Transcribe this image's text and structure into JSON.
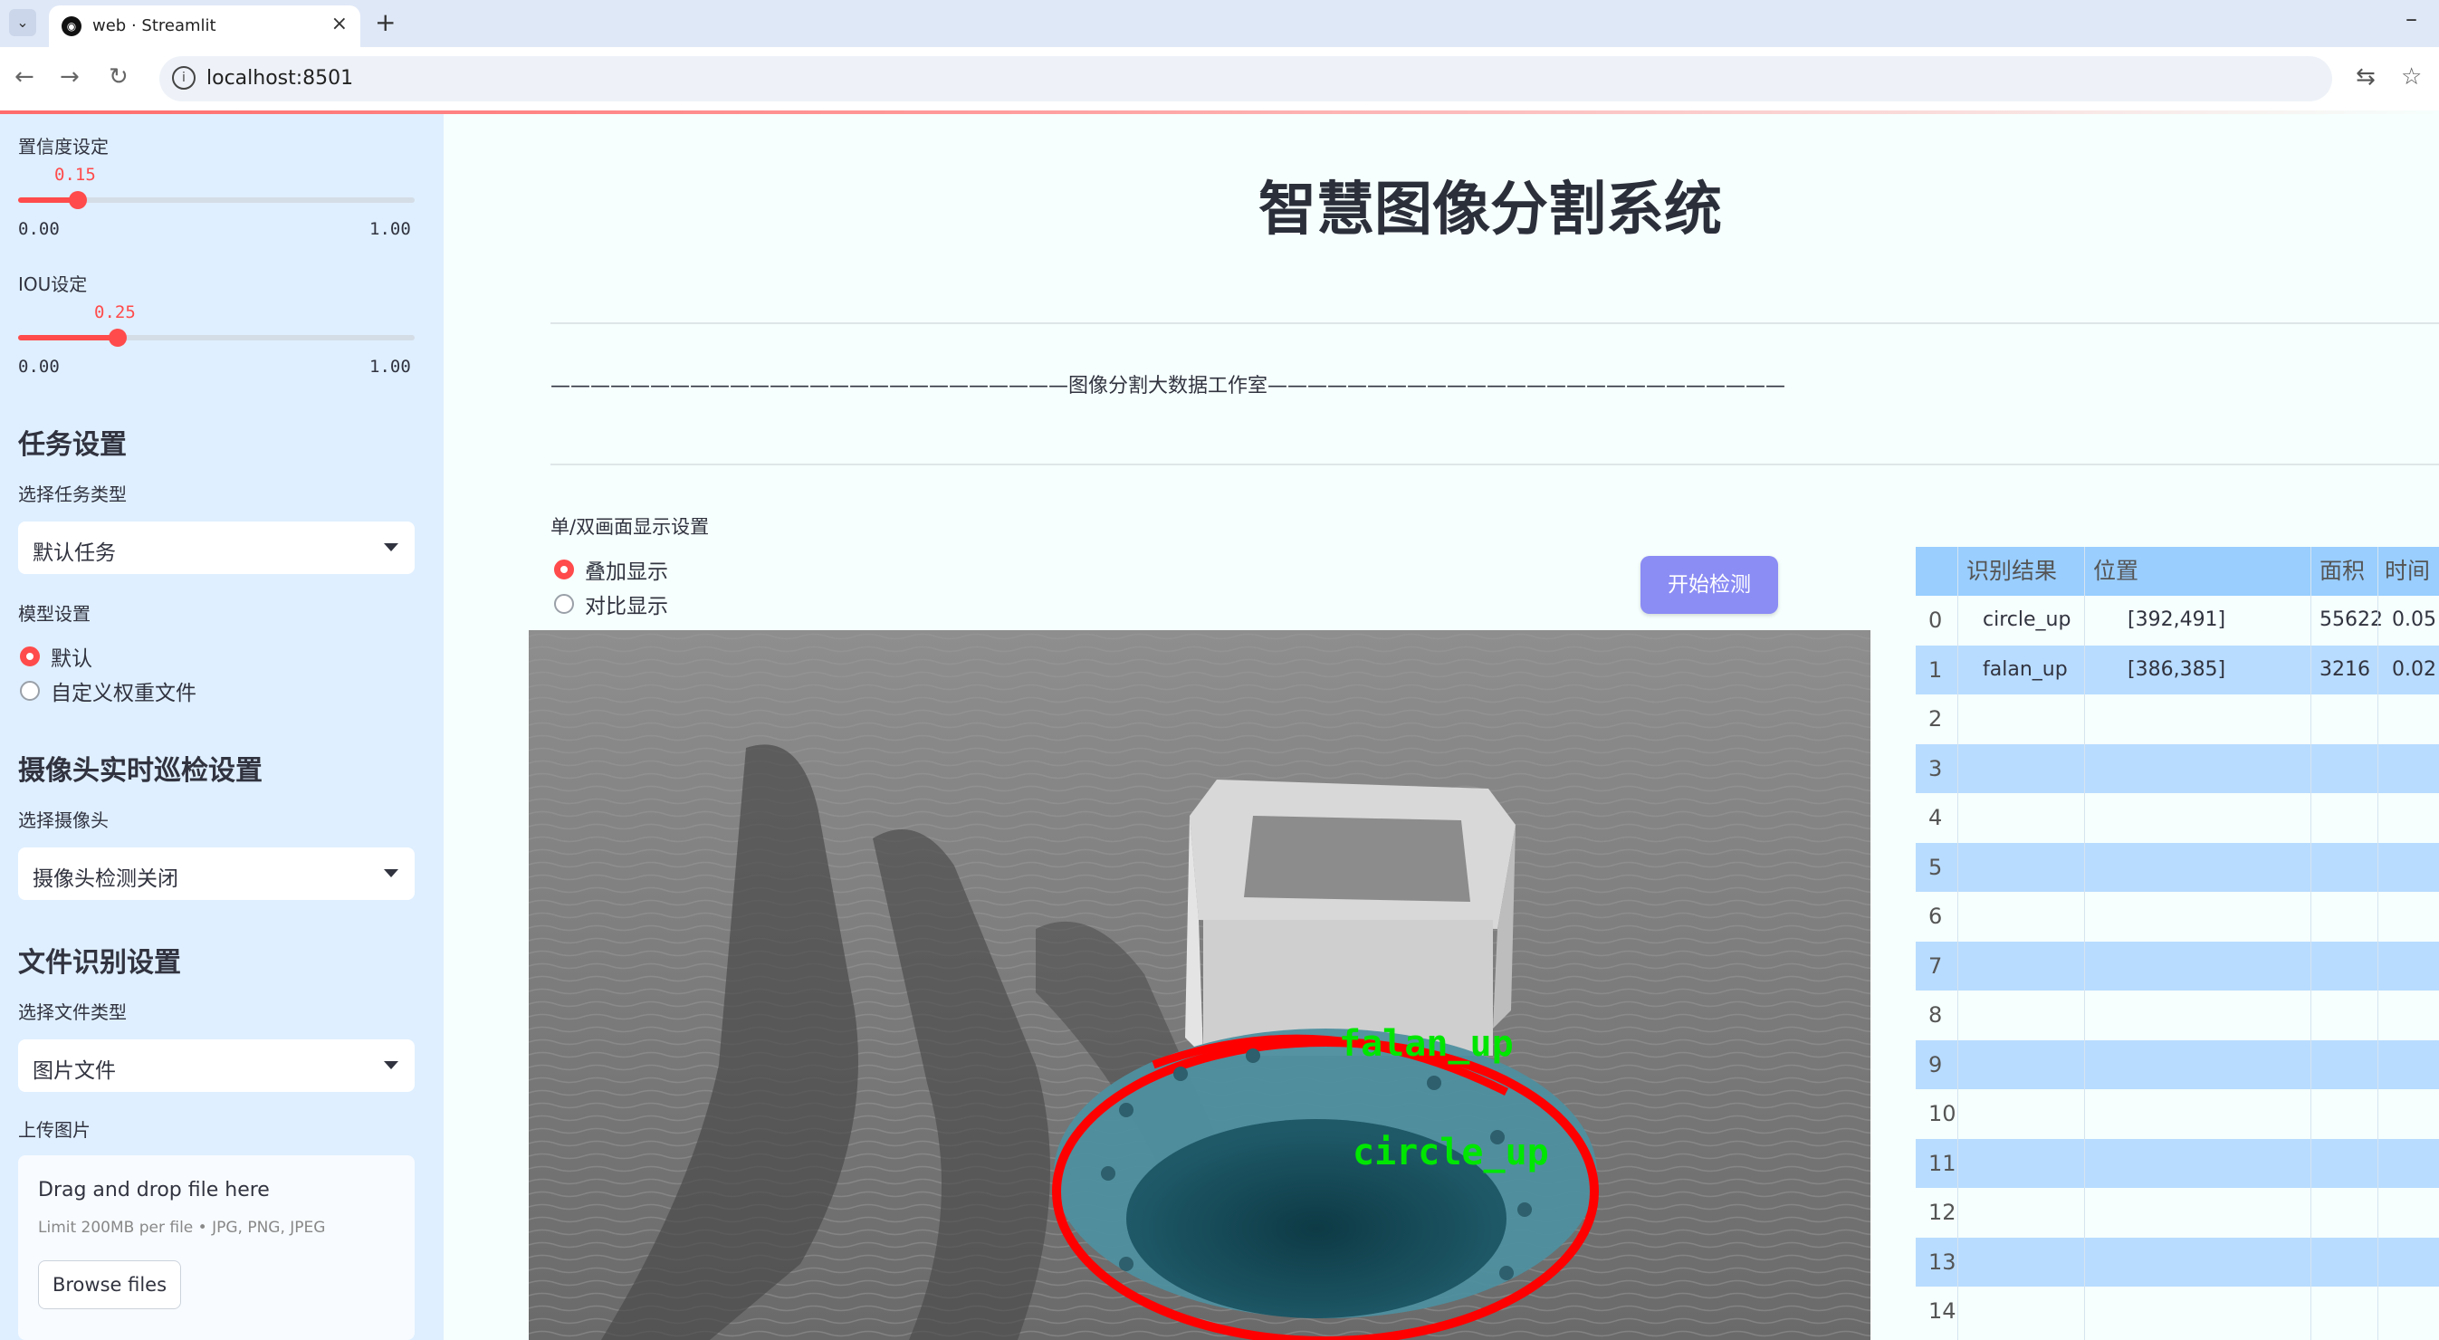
{
  "browser": {
    "tab_title": "web · Streamlit",
    "url": "localhost:8501"
  },
  "sidebar": {
    "confidence": {
      "label": "置信度设定",
      "value": "0.15",
      "fraction": 0.15,
      "min": "0.00",
      "max": "1.00"
    },
    "iou": {
      "label": "IOU设定",
      "value": "0.25",
      "fraction": 0.25,
      "min": "0.00",
      "max": "1.00"
    },
    "task_header": "任务设置",
    "task_type_label": "选择任务类型",
    "task_type_value": "默认任务",
    "model_label": "模型设置",
    "model_options": [
      "默认",
      "自定义权重文件"
    ],
    "model_selected": 0,
    "camera_header": "摄像头实时巡检设置",
    "camera_label": "选择摄像头",
    "camera_value": "摄像头检测关闭",
    "file_header": "文件识别设置",
    "file_type_label": "选择文件类型",
    "file_type_value": "图片文件",
    "upload_label": "上传图片",
    "upload_drop": "Drag and drop file here",
    "upload_limit": "Limit 200MB per file • JPG, PNG, JPEG",
    "upload_button": "Browse files"
  },
  "main": {
    "title": "智慧图像分割系统",
    "banner": "——————————————————————————图像分割大数据工作室——————————————————————————",
    "display_label": "单/双画面显示设置",
    "display_options": [
      "叠加显示",
      "对比显示"
    ],
    "display_selected": 0,
    "start_button": "开始检测",
    "detections": [
      "falan_up",
      "circle_up"
    ]
  },
  "table": {
    "headers": [
      "识别结果",
      "位置",
      "面积",
      "时间"
    ],
    "rows": [
      {
        "index": "0",
        "result": "circle_up",
        "position": "[392,491]",
        "area": "55622",
        "time": "0.05"
      },
      {
        "index": "1",
        "result": "falan_up",
        "position": "[386,385]",
        "area": "3216",
        "time": "0.02"
      },
      {
        "index": "2"
      },
      {
        "index": "3"
      },
      {
        "index": "4"
      },
      {
        "index": "5"
      },
      {
        "index": "6"
      },
      {
        "index": "7"
      },
      {
        "index": "8"
      },
      {
        "index": "9"
      },
      {
        "index": "10"
      },
      {
        "index": "11"
      },
      {
        "index": "12"
      },
      {
        "index": "13"
      },
      {
        "index": "14"
      }
    ]
  },
  "colors": {
    "accent": "#ff4b4b",
    "sidebar": "#dfefff",
    "button": "#8b8cf4",
    "table_row": "#b8dcff",
    "mask_outline": "#ff0000",
    "label_text": "#00e600"
  }
}
